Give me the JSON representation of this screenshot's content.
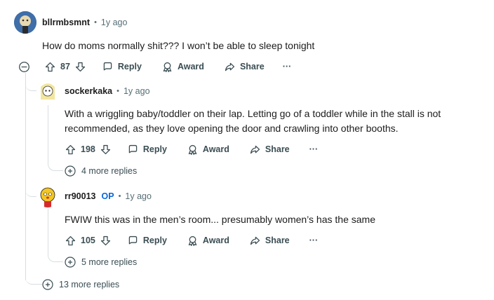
{
  "comments": [
    {
      "username": "bllrmbsmnt",
      "time": "1y ago",
      "body": "How do moms normally shit??? I won’t be able to sleep tonight",
      "votes": "87",
      "reply_label": "Reply",
      "award_label": "Award",
      "share_label": "Share",
      "more_replies": "13 more replies",
      "avatar_colors": [
        "#3f6ea8",
        "#e8d9b0",
        "#2b2b2b"
      ]
    },
    {
      "username": "sockerkaka",
      "time": "1y ago",
      "body": "With a wriggling baby/toddler on their lap. Letting go of a toddler while in the stall is not recommended, as they love opening the door and crawling into other booths.",
      "votes": "198",
      "reply_label": "Reply",
      "award_label": "Award",
      "share_label": "Share",
      "more_replies": "4 more replies",
      "avatar_colors": [
        "#f2e6a0",
        "#ffffff",
        "#333333"
      ]
    },
    {
      "username": "rr90013",
      "op_badge": "OP",
      "time": "1y ago",
      "body": "FWIW this was in the men’s room... presumably women’s has the same",
      "votes": "105",
      "reply_label": "Reply",
      "award_label": "Award",
      "share_label": "Share",
      "more_replies": "5 more replies",
      "avatar_colors": [
        "#f3c623",
        "#d62b2b",
        "#1c1c1c"
      ]
    }
  ],
  "separator": "•",
  "overflow_label": "···",
  "colors": {
    "op": "#0a66d8",
    "meta": "#576f76",
    "action": "#3a4d53",
    "thread": "#d7dde0"
  }
}
